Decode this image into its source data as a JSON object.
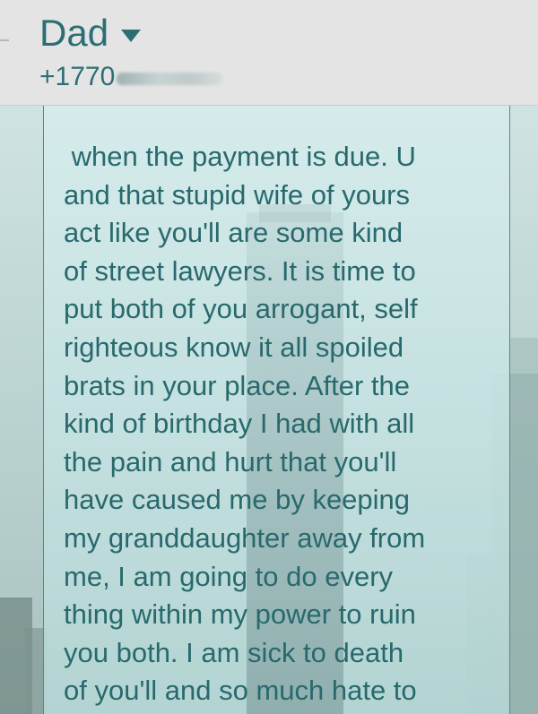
{
  "header": {
    "contact_name": "Dad",
    "phone_number": "+1770"
  },
  "message": {
    "lines": [
      " when the payment is due. U",
      "and that stupid wife of yours",
      "act like you'll are some kind",
      "of street lawyers. It is time to",
      "put both of you arrogant, self",
      "righteous know it all spoiled",
      "brats in your place. After the",
      "kind of birthday I had with all",
      "the pain and hurt that you'll",
      "have caused me by keeping",
      "my granddaughter away from",
      "me, I am going to do every",
      "thing within my power to ruin",
      "you both. I am sick to death",
      "of you'll and so much hate to"
    ]
  },
  "colors": {
    "accent": "#2b6f74",
    "message_text": "#28696d",
    "header_bg": "#e4e4e4",
    "bubble_border": "#6e7f7f"
  },
  "icons": {
    "dropdown": "triangle-down-icon"
  }
}
